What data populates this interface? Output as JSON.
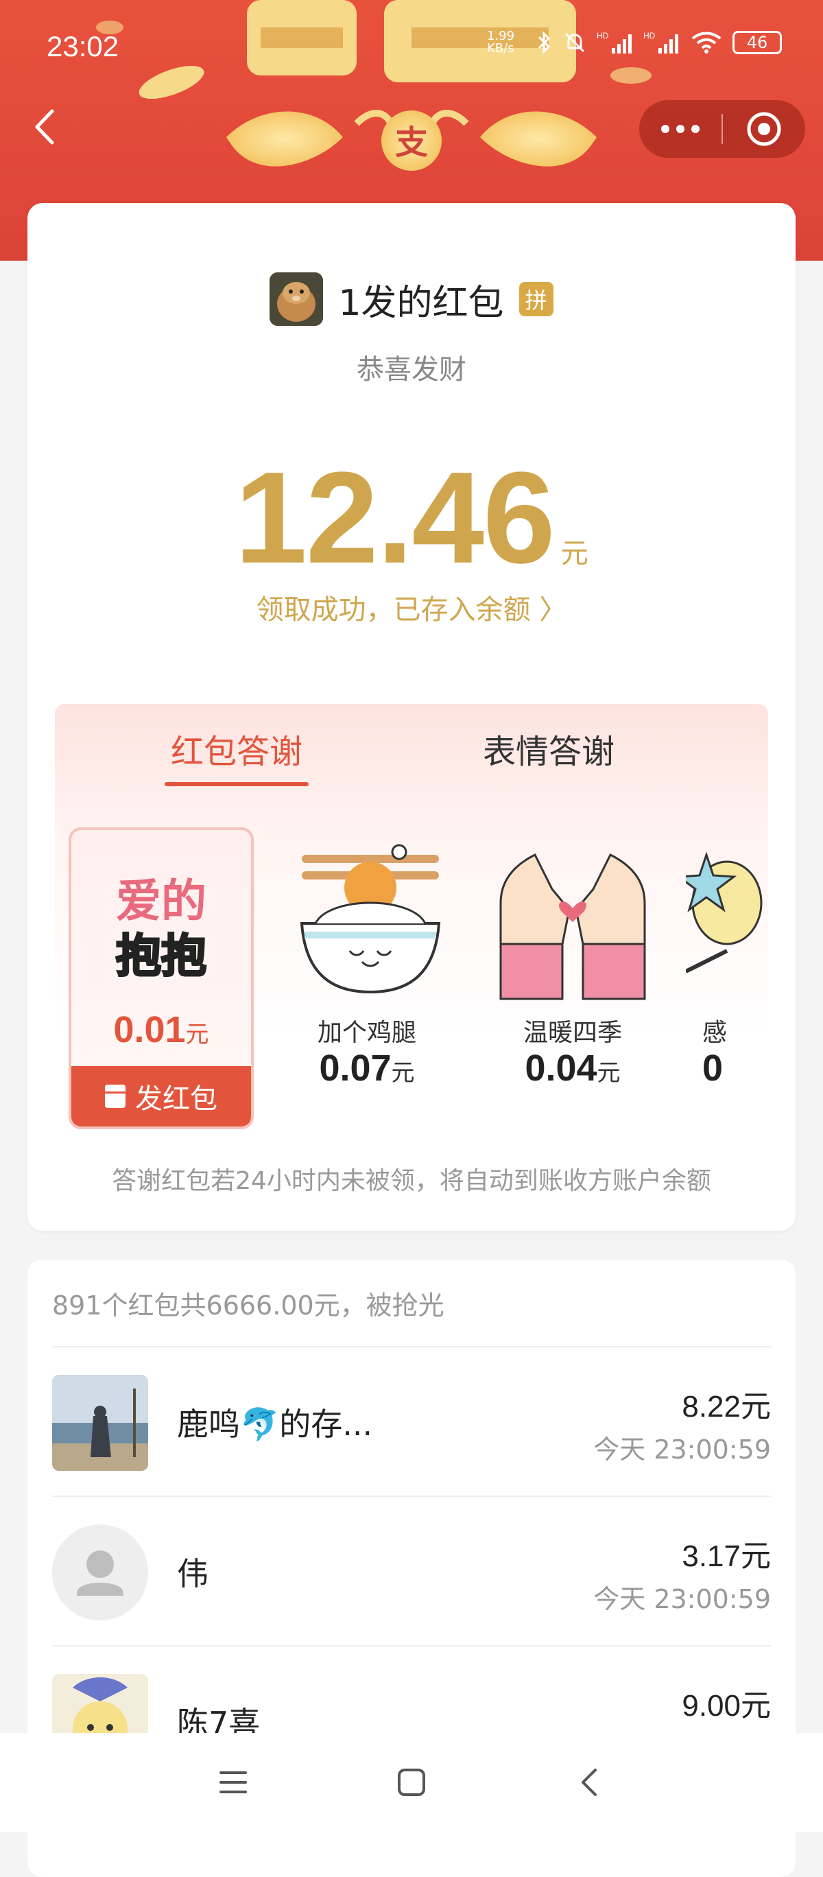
{
  "status_bar": {
    "time": "23:02",
    "net_speed": "1.99 KB/s",
    "battery": "46"
  },
  "header": {
    "back_icon": "chevron-left-icon",
    "menu_icon": "more-dots-icon",
    "close_icon": "target-icon",
    "banner_glyph": "支"
  },
  "packet": {
    "sender_name": "1发的红包",
    "badge": "拼",
    "blessing": "恭喜发财",
    "amount": "12.46",
    "unit": "元",
    "received_text": "领取成功，已存入余额 〉"
  },
  "thanks": {
    "tabs": [
      {
        "label": "红包答谢",
        "active": true
      },
      {
        "label": "表情答谢",
        "active": false
      }
    ],
    "gifts": [
      {
        "name": "爱的抱抱",
        "price": "0.01",
        "unit": "元",
        "art_text_1": "爱的",
        "art_text_2": "抱抱"
      },
      {
        "name": "加个鸡腿",
        "price": "0.07",
        "unit": "元"
      },
      {
        "name": "温暖四季",
        "price": "0.04",
        "unit": "元"
      },
      {
        "name": "感",
        "price": "0",
        "unit": ""
      }
    ],
    "send_button": "发红包",
    "note": "答谢红包若24小时内未被领，将自动到账收方账户余额"
  },
  "list": {
    "summary": "891个红包共6666.00元，被抢光",
    "rows": [
      {
        "name": "鹿鸣🐬的存...",
        "amount": "8.22元",
        "time": "今天 23:00:59"
      },
      {
        "name": "伟",
        "amount": "3.17元",
        "time": "今天 23:00:59"
      },
      {
        "name": "陈7喜",
        "amount": "9.00元",
        "time": ""
      }
    ]
  },
  "colors": {
    "banner_red": "#e0473a",
    "gold": "#cfa64d",
    "accent_red": "#e2553c"
  }
}
